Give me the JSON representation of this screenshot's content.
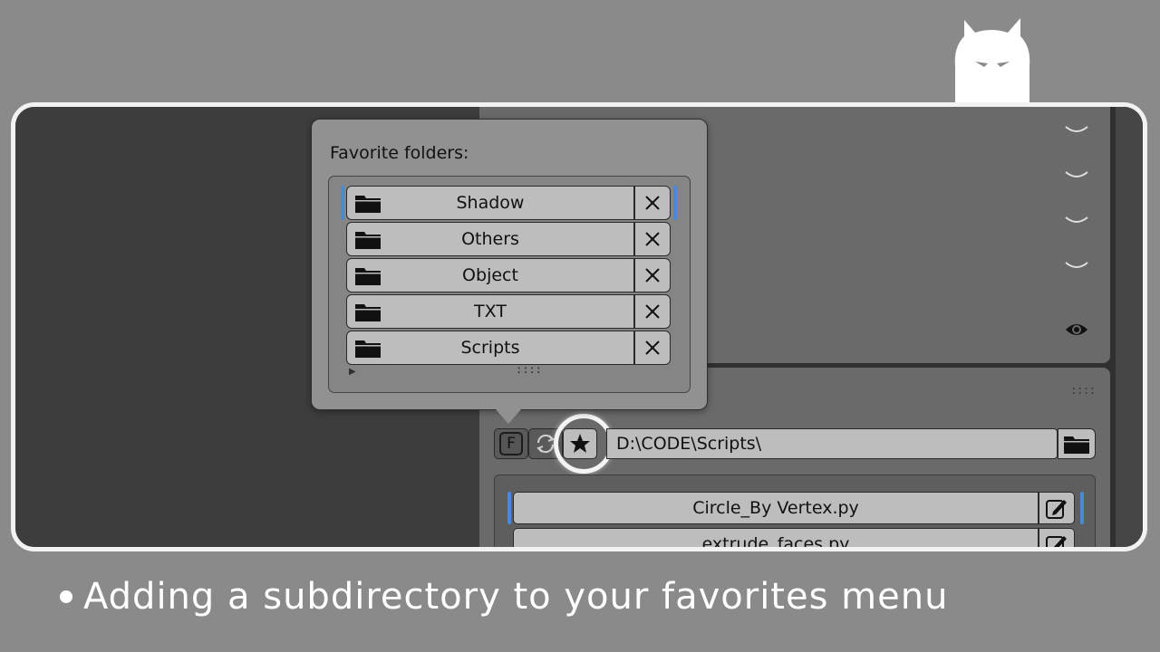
{
  "favorites_popup": {
    "title": "Favorite folders:",
    "items": [
      {
        "label": "Shadow",
        "active": true
      },
      {
        "label": "Others",
        "active": false
      },
      {
        "label": "Object",
        "active": false
      },
      {
        "label": "TXT",
        "active": false
      },
      {
        "label": "Scripts",
        "active": false
      }
    ],
    "remove_icon": "x-close-icon",
    "folder_icon": "folder-icon"
  },
  "toolbar": {
    "f_button_label": "F",
    "refresh_icon": "refresh-icon",
    "favorite_icon": "star-icon",
    "path_value": "D:\\CODE\\Scripts\\",
    "browse_icon": "folder-icon"
  },
  "scripts": [
    {
      "label": "Circle_By Vertex.py",
      "active": true
    },
    {
      "label": "extrude_faces.py",
      "active": false
    }
  ],
  "caption": {
    "text": "Adding a subdirectory to your favorites menu"
  },
  "colors": {
    "background": "#8a8a8a",
    "frame_border": "#f2f2f2",
    "accent_blue": "#4a88d8",
    "button_bg": "#bdbdbd"
  }
}
